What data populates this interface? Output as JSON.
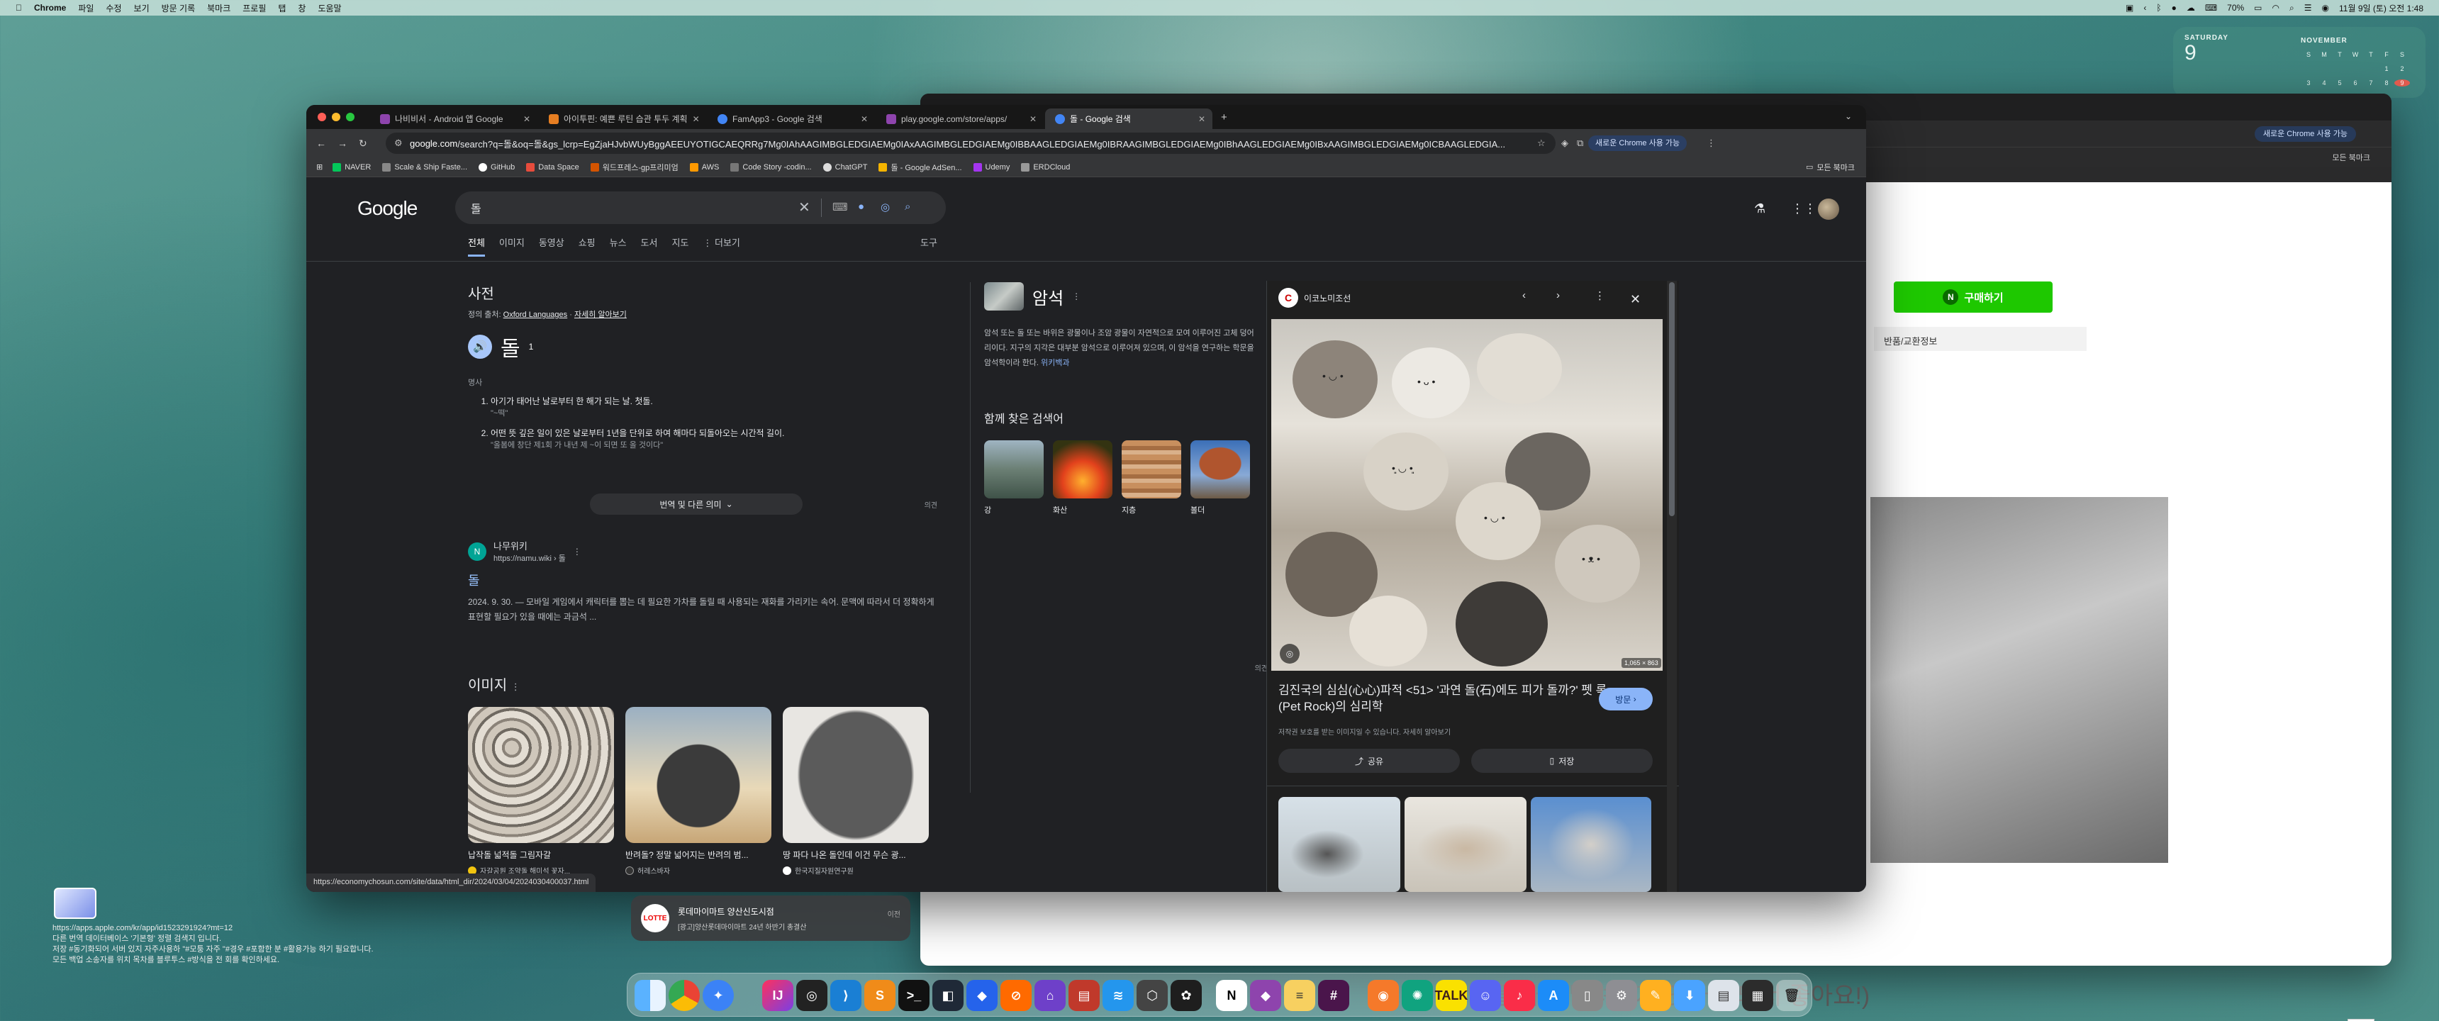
{
  "menubar": {
    "items": [
      "Chrome",
      "파일",
      "수정",
      "보기",
      "방문 기록",
      "북마크",
      "프로필",
      "탭",
      "창",
      "도움말"
    ],
    "battery": "70%",
    "datetime": "11월 9일 (토) 오전 1:48"
  },
  "widget": {
    "dow": "SATURDAY",
    "day": "9",
    "month": "NOVEMBER",
    "weekdays": [
      "S",
      "M",
      "T",
      "W",
      "T",
      "F",
      "S"
    ],
    "dates": [
      "",
      "",
      "",
      "",
      "",
      "1",
      "2",
      "3",
      "4",
      "5",
      "6",
      "7",
      "8",
      "9"
    ]
  },
  "bgwin": {
    "new_chrome": "새로운 Chrome 사용 가능",
    "all_bookmarks": "모든 북마크",
    "buy_label": "구매하기",
    "buy_badge": "N",
    "return_label": "반품/교환정보",
    "caption": "( 털을 따로 말려주지 않아도 돼서 좋아요!)",
    "up": "︿"
  },
  "tabs": [
    {
      "title": "나비비서 - Android 앱 Google",
      "color": "#8e44ad"
    },
    {
      "title": "아이투핀: 예쁜 루틴 습관 투두 계획",
      "color": "#e67e22"
    },
    {
      "title": "FamApp3 - Google 검색",
      "color": "#4285f4"
    },
    {
      "title": "play.google.com/store/apps/",
      "color": "#8e44ad"
    },
    {
      "title": "돌 - Google 검색",
      "color": "#4285f4"
    }
  ],
  "toolbar": {
    "url_host": "google.com",
    "url_path": "/search?q=돌&oq=돌&gs_lcrp=EgZjaHJvbWUyBggAEEUYOTIGCAEQRRg7Mg0IAhAAGIMBGLEDGIAEMg0IAxAAGIMBGLEDGIAEMg0IBBAAGLEDGIAEMg0IBRAAGIMBGLEDGIAEMg0IBhAAGLEDGIAEMg0IBxAAGIMBGLEDGIAEMg0ICBAAGLEDGIA...",
    "new_chrome": "새로운 Chrome 사용 가능"
  },
  "bookmarks": {
    "items": [
      {
        "label": "NAVER",
        "color": "#03c75a"
      },
      {
        "label": "Scale & Ship Faste...",
        "color": "#888"
      },
      {
        "label": "GitHub",
        "color": "#fff"
      },
      {
        "label": "Data Space",
        "color": "#e74c3c"
      },
      {
        "label": "워드프레스-gp프리미엄",
        "color": "#d35400"
      },
      {
        "label": "AWS",
        "color": "#ff9900"
      },
      {
        "label": "Code Story -codin...",
        "color": "#777"
      },
      {
        "label": "ChatGPT",
        "color": "#ddd"
      },
      {
        "label": "돌 - Google AdSen...",
        "color": "#f4b400"
      },
      {
        "label": "Udemy",
        "color": "#a435f0"
      },
      {
        "label": "ERDCloud",
        "color": "#999"
      }
    ],
    "all": "모든 북마크"
  },
  "google": {
    "logo": "Google",
    "query": "돌",
    "tabs": [
      "전체",
      "이미지",
      "동영상",
      "쇼핑",
      "뉴스",
      "도서",
      "지도",
      "⋮ 더보기"
    ],
    "tools": "도구"
  },
  "dict": {
    "heading": "사전",
    "source_label": "정의 출처:",
    "source": "Oxford Languages",
    "more": "자세히 알아보기",
    "word": "돌",
    "sup": "1",
    "pos": "명사",
    "defs": [
      {
        "text": "아기가 태어난 날로부터 한 해가 되는 날. 첫돌.",
        "ex": "\"~떡\""
      },
      {
        "text": "어떤 뜻 깊은 일이 있은 날로부터 1년을 단위로 하여 해마다 되돌아오는 시간적 길이.",
        "ex": "\"올봄에 창단 제1회 가 내년 제 ~이 되면 또 올 것이다\""
      }
    ],
    "opinion": "의견",
    "more_meaning": "번역 및 다른 의미"
  },
  "namu": {
    "site": "나무위키",
    "url": "https://namu.wiki › 돌",
    "title": "돌",
    "snippet": "2024. 9. 30. — 모바일 게임에서 캐릭터를 뽑는 데 필요한 가차를 돌릴 때 사용되는 재화를 가리키는 속어. 문맥에 따라서 더 정확하게 표현할 필요가 있을 때에는 과금석 ..."
  },
  "images": {
    "heading": "이미지",
    "cards": [
      {
        "caption": "납작돌 넓적돌 그림자갈",
        "source": "자갈공원 조약돌 해미석 꽃자..."
      },
      {
        "caption": "반려돌? 정말 넓어지는 반려의 범...",
        "source": "허레스바자"
      },
      {
        "caption": "땅 파다 나온 돌인데 이건 무슨 광...",
        "source": "한국지질자원연구원"
      }
    ]
  },
  "status_url": "https://economychosun.com/site/data/html_dir/2024/03/04/2024030400037.html",
  "kp": {
    "title": "암석",
    "desc": "암석 또는 돌 또는 바위은 광물이나 조암 광물이 자연적으로 모여 이루어진 고체 덩어리이다. 지구의 지각은 대부분 암석으로 이루어져 있으며, 이 암석을 연구하는 학문을 암석학이라 한다.",
    "desc_link": "위키백과",
    "also": "함께 찾은 검색어",
    "items": [
      "강",
      "화산",
      "지층",
      "볼더"
    ],
    "opinion": "의견"
  },
  "viewer": {
    "source": "이코노미조선",
    "dims": "1,065 × 863",
    "title": "김진국의 심심(心心)파적 <51> '과연 돌(石)에도 피가 돌까?' 펫 록(Pet Rock)의 심리학",
    "visit": "방문",
    "note": "저작권 보호를 받는 이미지일 수 있습니다.  자세히 알아보기",
    "share": "공유",
    "save": "저장"
  },
  "notif": {
    "title": "롯데마이마트 양산신도시점",
    "sub": "[광고]양산롯데마이마트 24년 하반기 총결산",
    "time": "이전"
  },
  "desktop_note": [
    "https://apps.apple.com/kr/app/id1523291924?mt=12",
    "다른 번역 데이터베이스 '기본형' 정렬 검색지 입니다.",
    "저장 #동기화되어 서버 있지 자주사용하 \"#모퉁 자주 \"#경우 #포함한 분 #활용가능 하기 필요합니다.",
    "모든 백업 소송자를 위치 목차를 블루투스 #방식을 전 회를 확인하세요."
  ],
  "dock": [
    "finder",
    "chrome",
    "safari",
    "intellij",
    "sublime",
    "vscode",
    "terminal",
    "jetbrains",
    "notion",
    "slack",
    "discord",
    "music",
    "appstore",
    "settings"
  ]
}
